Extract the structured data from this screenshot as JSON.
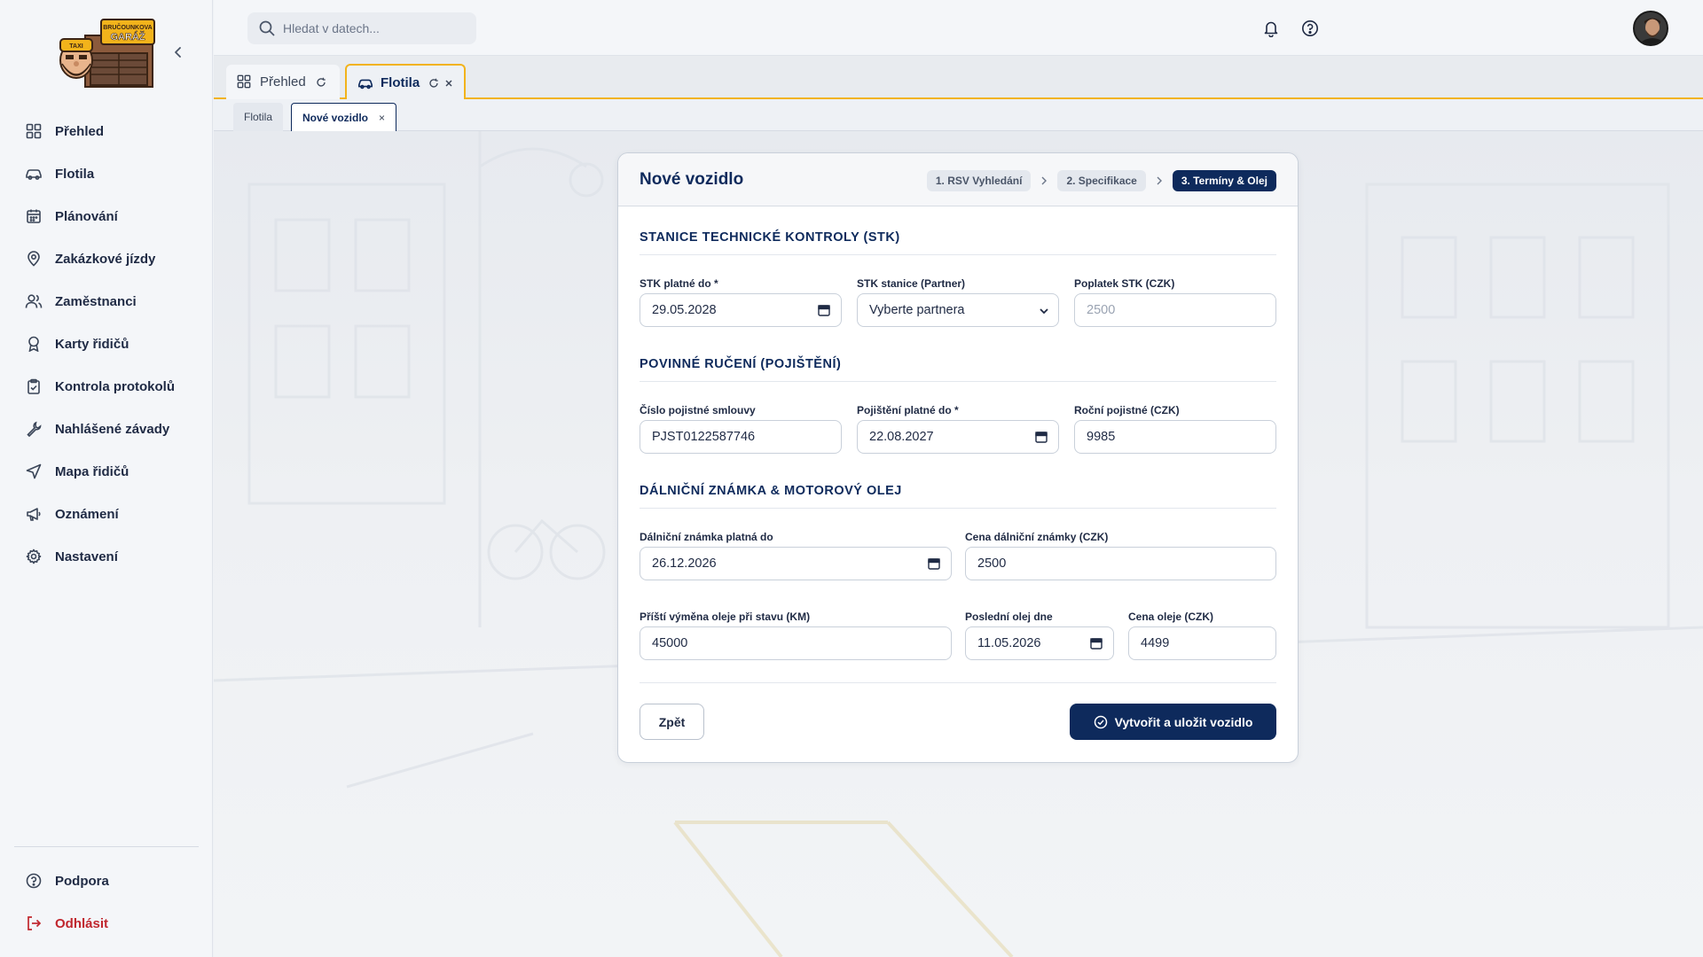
{
  "brand": {
    "logo_text_top": "BRUČOUNKOVA",
    "logo_text_bottom": "GARÁŽ",
    "logo_sign": "TAXI",
    "accent_color": "#f2b31b",
    "primary_color": "#0e2a5c",
    "danger_color": "#c0262d"
  },
  "sidebar": {
    "items": [
      {
        "label": "Přehled",
        "icon": "dashboard-icon"
      },
      {
        "label": "Flotila",
        "icon": "car-icon"
      },
      {
        "label": "Plánování",
        "icon": "calendar-icon"
      },
      {
        "label": "Zakázkové jízdy",
        "icon": "map-pin-icon"
      },
      {
        "label": "Zaměstnanci",
        "icon": "users-icon"
      },
      {
        "label": "Karty řidičů",
        "icon": "award-icon"
      },
      {
        "label": "Kontrola protokolů",
        "icon": "clipboard-check-icon"
      },
      {
        "label": "Nahlášené závady",
        "icon": "wrench-icon"
      },
      {
        "label": "Mapa řidičů",
        "icon": "navigation-icon"
      },
      {
        "label": "Oznámení",
        "icon": "megaphone-icon"
      },
      {
        "label": "Nastavení",
        "icon": "gear-icon"
      }
    ],
    "support_label": "Podpora",
    "logout_label": "Odhlásit"
  },
  "topbar": {
    "search_placeholder": "Hledat v datech..."
  },
  "tabs": [
    {
      "label": "Přehled",
      "icon": "dashboard-icon"
    },
    {
      "label": "Flotila",
      "icon": "car-icon",
      "active": true
    }
  ],
  "subtabs": [
    {
      "label": "Flotila"
    },
    {
      "label": "Nové vozidlo",
      "active": true,
      "close": "×"
    }
  ],
  "form": {
    "title": "Nové vozidlo",
    "steps": [
      "1. RSV Vyhledání",
      "2. Specifikace",
      "3. Termíny & Olej"
    ],
    "active_step": 3,
    "sections": {
      "stk": "STANICE TECHNICKÉ KONTROLY (STK)",
      "insurance": "POVINNÉ RUČENÍ (POJIŠTĚNÍ)",
      "vignette_oil": "DÁLNIČNÍ ZNÁMKA & MOTOROVÝ OLEJ"
    },
    "fields": {
      "stk_valid_until": {
        "label": "STK platné do *",
        "value": "29.05.2028"
      },
      "stk_station": {
        "label": "STK stanice (Partner)",
        "value": "Vyberte partnera"
      },
      "stk_fee": {
        "label": "Poplatek STK (CZK)",
        "placeholder": "2500"
      },
      "policy_number": {
        "label": "Číslo pojistné smlouvy",
        "value": "PJST0122587746"
      },
      "insurance_valid_until": {
        "label": "Pojištění platné do *",
        "value": "22.08.2027"
      },
      "annual_premium": {
        "label": "Roční pojistné (CZK)",
        "value": "9985"
      },
      "vignette_valid_until": {
        "label": "Dálniční známka platná do",
        "value": "26.12.2026"
      },
      "vignette_price": {
        "label": "Cena dálniční známky (CZK)",
        "value": "2500"
      },
      "next_oil_change_km": {
        "label": "Příští výměna oleje při stavu (KM)",
        "value": "45000"
      },
      "last_oil_date": {
        "label": "Poslední olej dne",
        "value": "11.05.2026"
      },
      "oil_price": {
        "label": "Cena oleje (CZK)",
        "value": "4499"
      }
    },
    "back_label": "Zpět",
    "submit_label": "Vytvořit a uložit vozidlo"
  }
}
